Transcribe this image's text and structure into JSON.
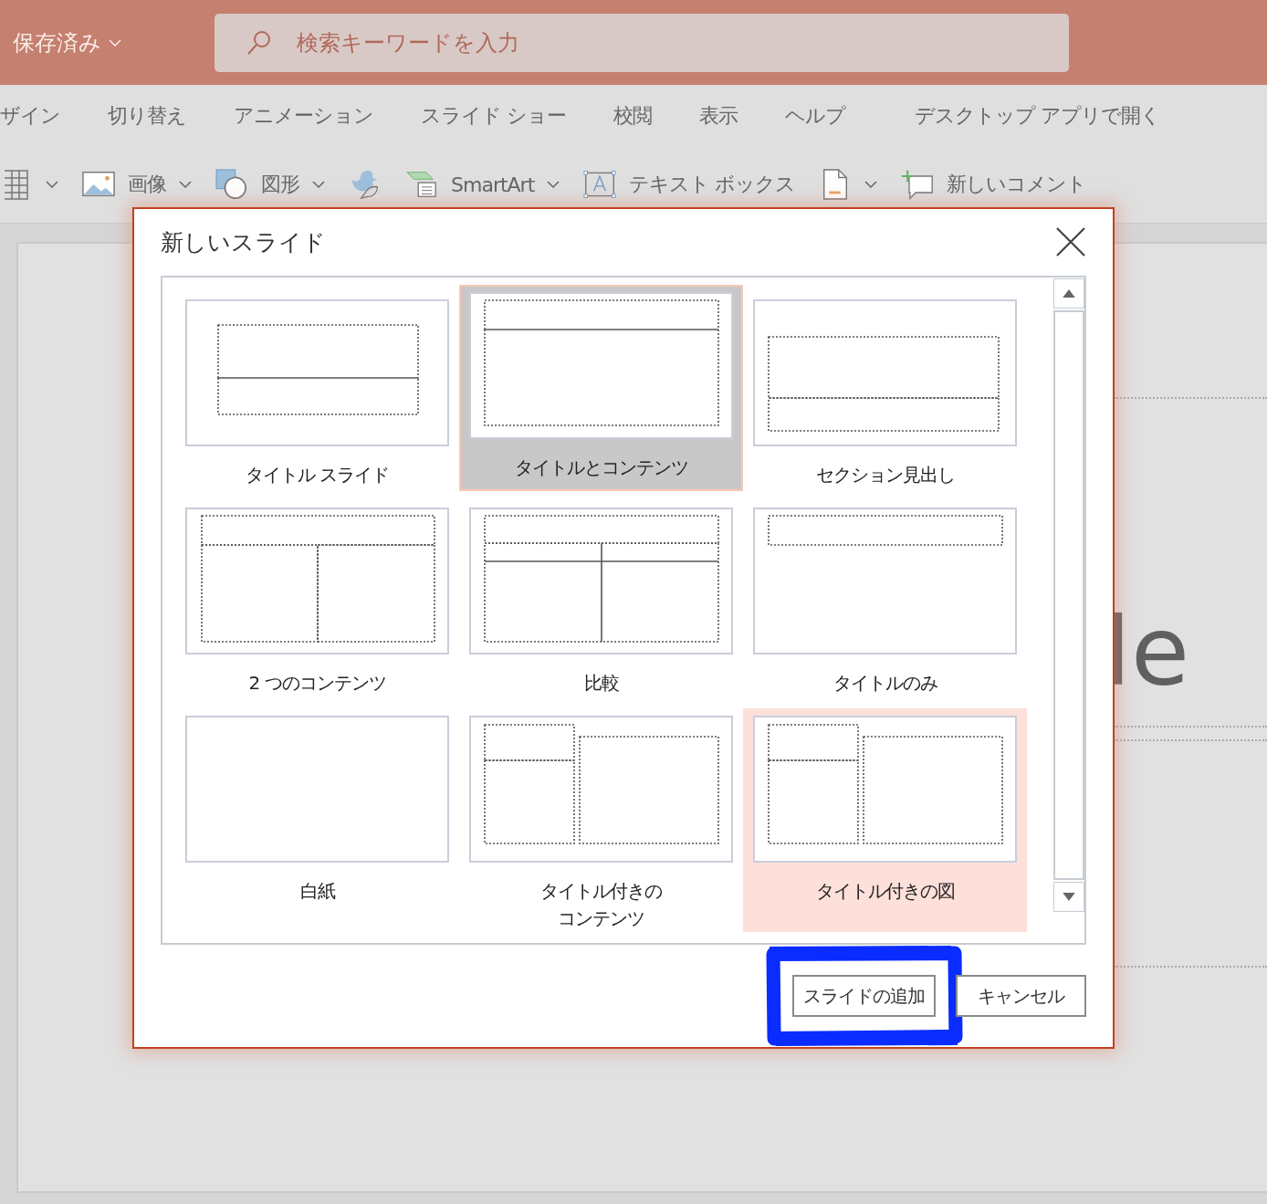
{
  "title_bar": {
    "save_status": "保存済み",
    "search": {
      "placeholder": "検索キーワードを入力"
    }
  },
  "ribbon_tabs": [
    {
      "label": "ザイン"
    },
    {
      "label": "切り替え"
    },
    {
      "label": "アニメーション"
    },
    {
      "label": "スライド ショー"
    },
    {
      "label": "校閲"
    },
    {
      "label": "表示"
    },
    {
      "label": "ヘルプ"
    }
  ],
  "open_desktop": "デスクトップ アプリで開く",
  "toolbar": [
    {
      "kind": "table",
      "dropdown": true
    },
    {
      "kind": "picture",
      "label": "画像",
      "dropdown": true
    },
    {
      "kind": "shapes",
      "label": "図形",
      "dropdown": true
    },
    {
      "kind": "icons",
      "dropdown": false
    },
    {
      "kind": "smartart",
      "label": "SmartArt",
      "dropdown": true
    },
    {
      "kind": "textbox",
      "label": "テキスト ボックス",
      "dropdown": false
    },
    {
      "kind": "document",
      "dropdown": true
    },
    {
      "kind": "comment",
      "label": "新しいコメント",
      "dropdown": false
    }
  ],
  "slide": {
    "title_fragment": "le"
  },
  "dialog": {
    "title": "新しいスライド",
    "layouts": [
      {
        "kind": "title-slide",
        "label": "タイトル スライド",
        "selected": false,
        "hovered": false
      },
      {
        "kind": "title-content",
        "label": "タイトルとコンテンツ",
        "selected": true,
        "hovered": false
      },
      {
        "kind": "section-header",
        "label": "セクション見出し",
        "selected": false,
        "hovered": false
      },
      {
        "kind": "two-content",
        "label": "2 つのコンテンツ",
        "selected": false,
        "hovered": false
      },
      {
        "kind": "comparison",
        "label": "比較",
        "selected": false,
        "hovered": false
      },
      {
        "kind": "title-only",
        "label": "タイトルのみ",
        "selected": false,
        "hovered": false
      },
      {
        "kind": "blank",
        "label": "白紙",
        "selected": false,
        "hovered": false
      },
      {
        "kind": "content-caption",
        "label": "タイトル付きのコンテンツ",
        "selected": false,
        "hovered": false
      },
      {
        "kind": "picture-caption",
        "label": "タイトル付きの図",
        "selected": false,
        "hovered": true
      }
    ],
    "buttons": [
      {
        "label": "スライドの追加",
        "highlighted": true
      },
      {
        "label": "キャンセル",
        "highlighted": false
      }
    ]
  }
}
